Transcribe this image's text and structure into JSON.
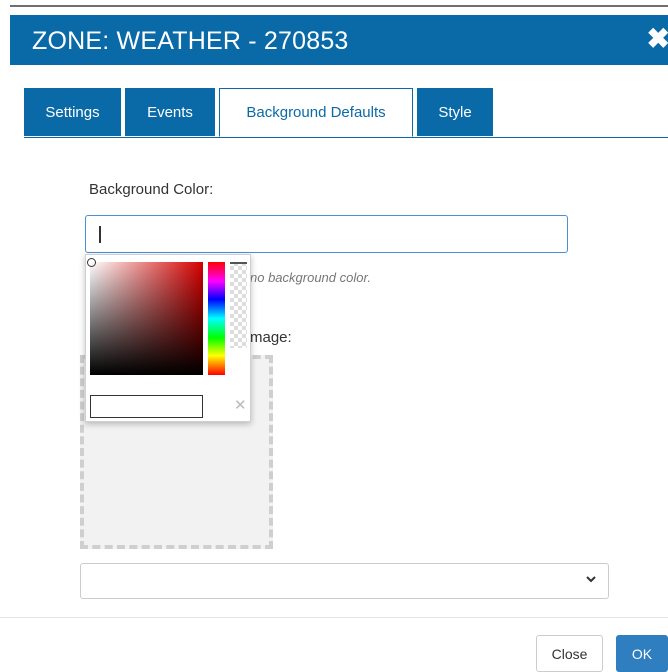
{
  "dialog": {
    "title": "ZONE: WEATHER - 270853",
    "close_icon": "close-icon"
  },
  "tabs": [
    {
      "label": "Settings",
      "active": false
    },
    {
      "label": "Events",
      "active": false
    },
    {
      "label": "Background Defaults",
      "active": true
    },
    {
      "label": "Style",
      "active": false
    }
  ],
  "background_color": {
    "label": "Background Color:",
    "value": "",
    "hint": "no background color."
  },
  "background_image": {
    "label": "mage:",
    "select_value": ""
  },
  "color_picker": {
    "hue_color": "#d50000",
    "input_value": "",
    "clear_icon": "clear-icon"
  },
  "footer": {
    "close_label": "Close",
    "ok_label": "OK"
  },
  "colors": {
    "primary": "#0a6aa8",
    "button_primary": "#2e7ec0"
  }
}
